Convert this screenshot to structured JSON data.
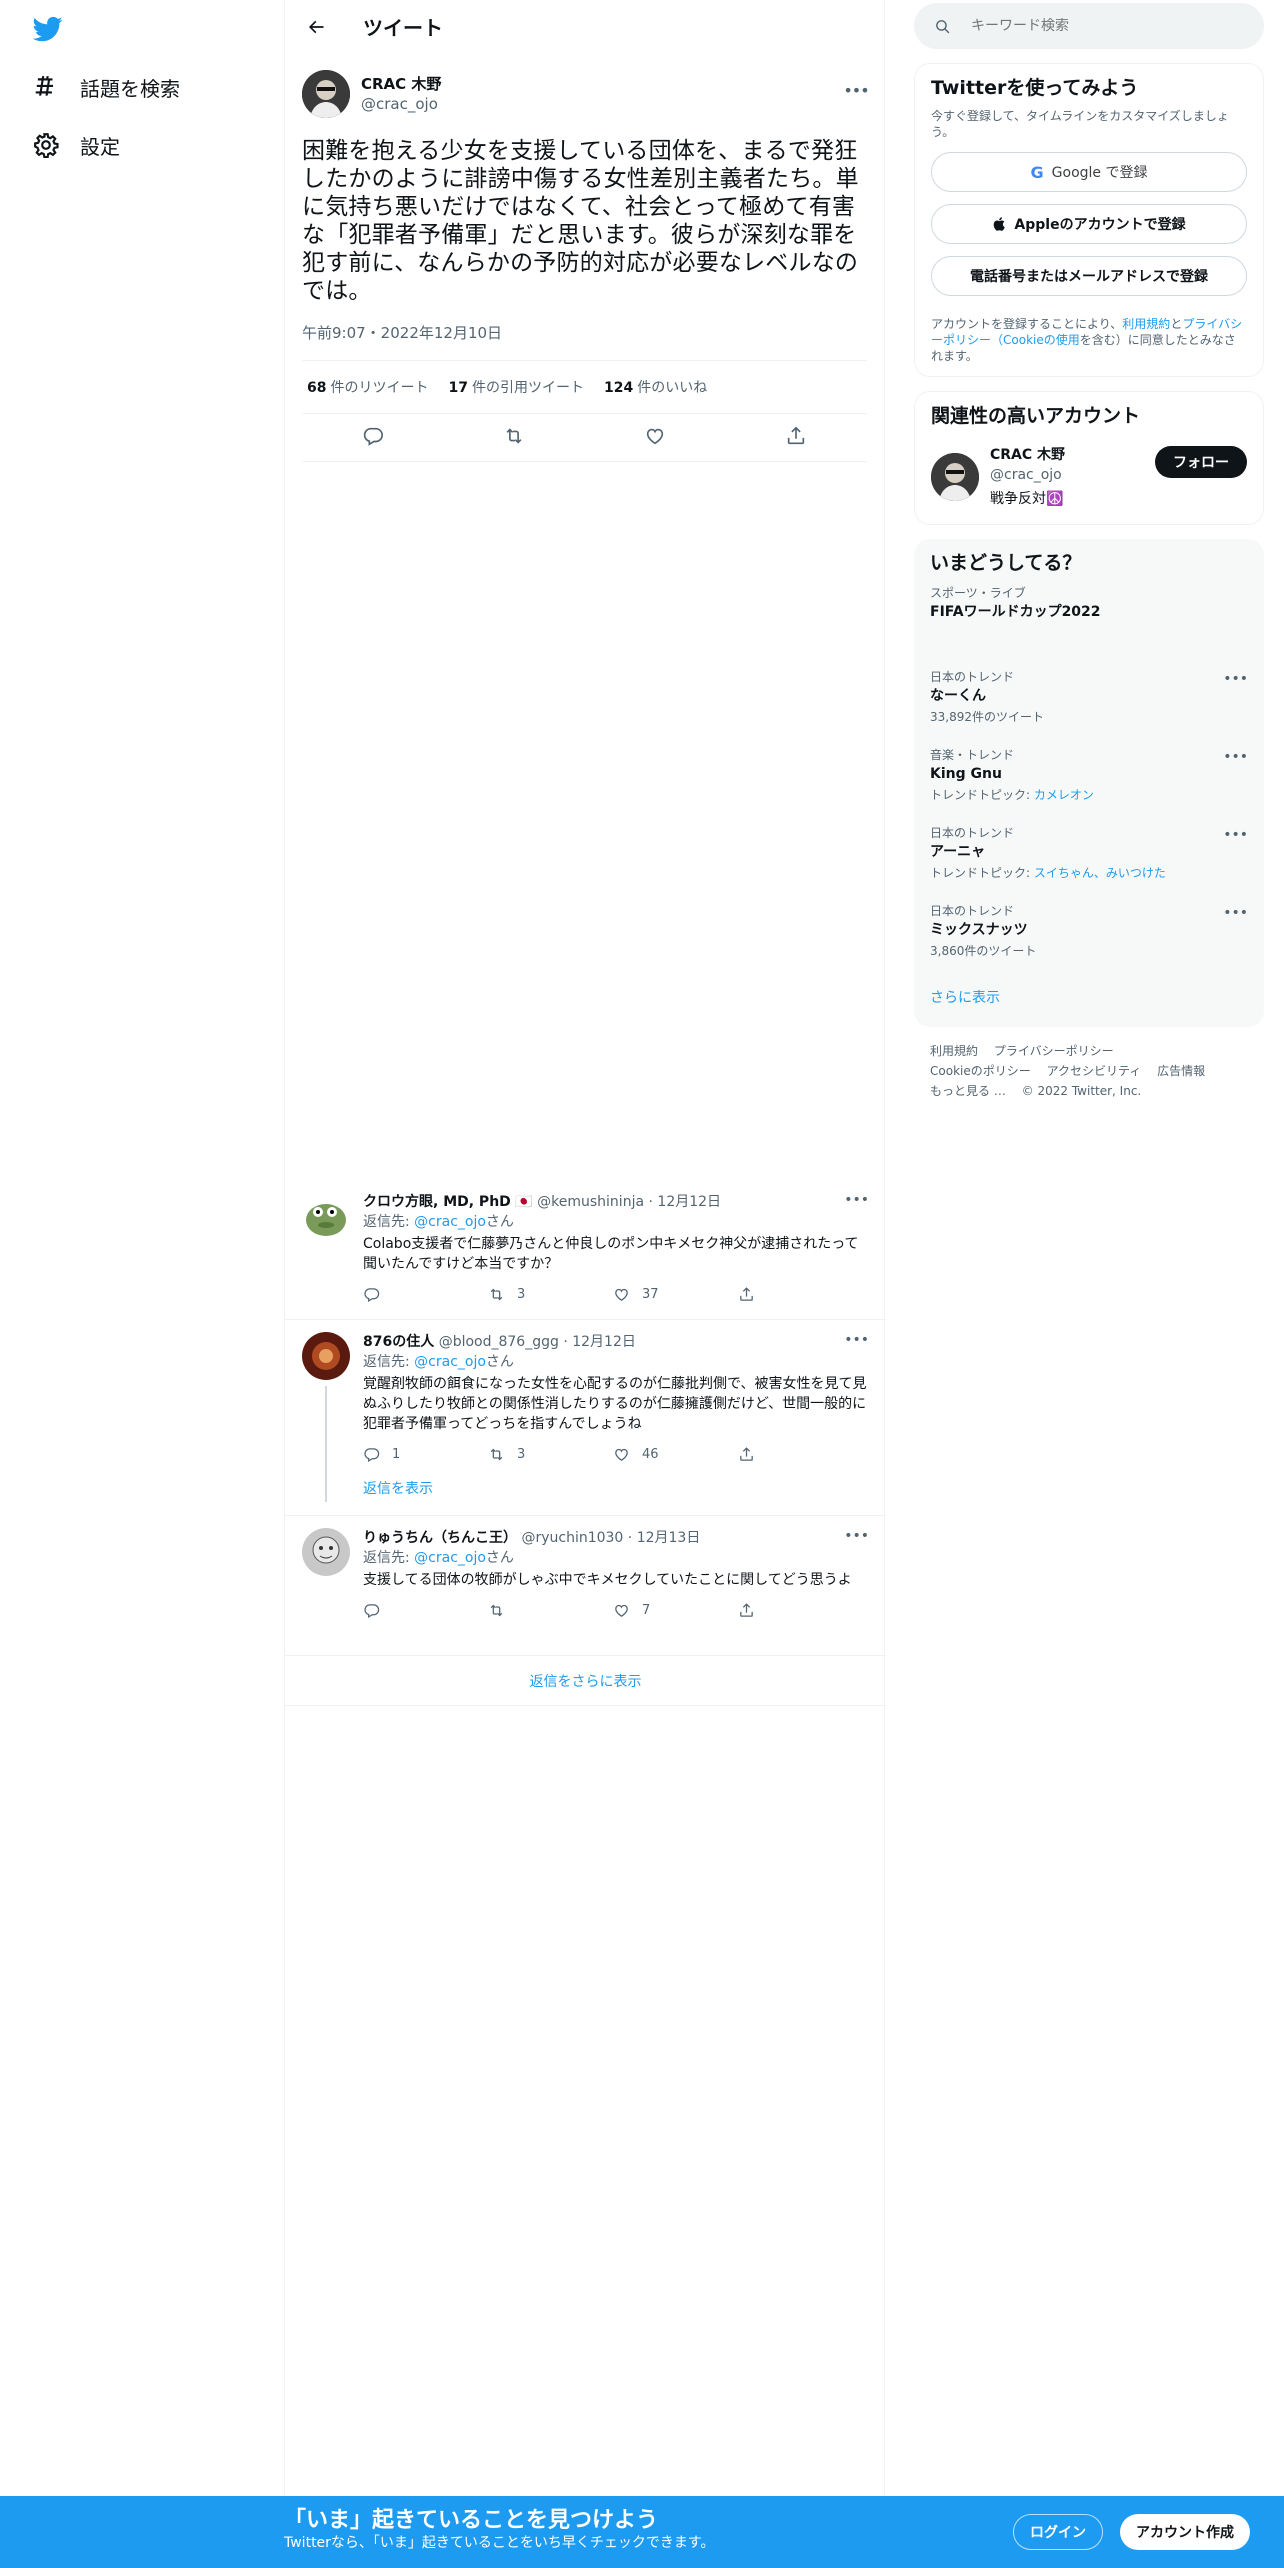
{
  "nav": {
    "logo_icon": "twitter-bird-icon",
    "items": [
      {
        "label": "話題を検索",
        "icon": "hashtag-icon"
      },
      {
        "label": "設定",
        "icon": "gear-icon"
      }
    ]
  },
  "header": {
    "title": "ツイート",
    "back_icon": "arrow-left-icon"
  },
  "tweet": {
    "author_name": "CRAC 木野",
    "author_handle": "@crac_ojo",
    "text": "困難を抱える少女を支援している団体を、まるで発狂したかのように誹謗中傷する女性差別主義者たち。単に気持ち悪いだけではなくて、社会とって極めて有害な「犯罪者予備軍」だと思います。彼らが深刻な罪を犯す前に、なんらかの予防的対応が必要なレベルなのでは。",
    "time": "午前9:07・2022年12月10日",
    "stats": [
      {
        "count": "68",
        "label": "件のリツイート"
      },
      {
        "count": "17",
        "label": "件の引用ツイート"
      },
      {
        "count": "124",
        "label": "件のいいね"
      }
    ]
  },
  "replies": [
    {
      "name": "クロウ方眼, MD, PhD",
      "flag": "🇯🇵",
      "handle": "@kemushininja",
      "date": "12月12日",
      "reply_to_prefix": "返信先: ",
      "reply_to": "@crac_ojo",
      "reply_to_suffix": "さん",
      "text": "Colabo支援者で仁藤夢乃さんと仲良しのポン中キメセク神父が逮捕されたって聞いたんですけど本当ですか？",
      "replies": "",
      "retweets": "3",
      "likes": "37"
    },
    {
      "name": "876の住人",
      "handle": "@blood_876_ggg",
      "date": "12月12日",
      "reply_to_prefix": "返信先: ",
      "reply_to": "@crac_ojo",
      "reply_to_suffix": "さん",
      "text": "覚醒剤牧師の餌食になった女性を心配するのが仁藤批判側で、被害女性を見て見ぬふりしたり牧師との関係性消したりするのが仁藤擁護側だけど、世間一般的に犯罪者予備軍ってどっちを指すんでしょうね",
      "replies": "1",
      "retweets": "3",
      "likes": "46",
      "show_replies": "返信を表示"
    },
    {
      "name": "りゅうちん（ちんこ王）",
      "handle": "@ryuchin1030",
      "date": "12月13日",
      "reply_to_prefix": "返信先: ",
      "reply_to": "@crac_ojo",
      "reply_to_suffix": "さん",
      "text": "支援してる団体の牧師がしゃぶ中でキメセクしていたことに関してどう思うよ",
      "replies": "",
      "retweets": "",
      "likes": "7"
    }
  ],
  "more_replies": "返信をさらに表示",
  "search": {
    "placeholder": "キーワード検索"
  },
  "signup": {
    "title": "Twitterを使ってみよう",
    "subtitle": "今すぐ登録して、タイムラインをカスタマイズしましょう。",
    "google": "Google で登録",
    "apple": "Appleのアカウントで登録",
    "phone": "電話番号またはメールアドレスで登録",
    "legal_1": "アカウントを登録することにより、",
    "legal_terms": "利用規約",
    "legal_2": "と",
    "legal_privacy": "プライバシーポリシー（Cookieの使用",
    "legal_3": "を含む）に同意したとみなされます。"
  },
  "related": {
    "title": "関連性の高いアカウント",
    "name": "CRAC 木野",
    "handle": "@crac_ojo",
    "bio": "戦争反対☮️",
    "follow": "フォロー"
  },
  "trends": {
    "title": "いまどうしてる？",
    "items": [
      {
        "context": "スポーツ・ライブ",
        "title": "FIFAワールドカップ2022",
        "meta": "",
        "link": ""
      },
      {
        "context": "日本のトレンド",
        "title": "なーくん",
        "meta": "33,892件のツイート",
        "link": ""
      },
      {
        "context": "音楽・トレンド",
        "title": "King Gnu",
        "meta": "トレンドトピック: ",
        "link": "カメレオン"
      },
      {
        "context": "日本のトレンド",
        "title": "アーニャ",
        "meta": "トレンドトピック: ",
        "link": "スイちゃん、みいつけた"
      },
      {
        "context": "日本のトレンド",
        "title": "ミックスナッツ",
        "meta": "3,860件のツイート",
        "link": ""
      }
    ],
    "show_more": "さらに表示"
  },
  "footer": {
    "links": [
      "利用規約",
      "プライバシーポリシー",
      "Cookieのポリシー",
      "アクセシビリティ",
      "広告情報",
      "もっと見る …",
      "© 2022 Twitter, Inc."
    ]
  },
  "banner": {
    "title": "「いま」起きていることを見つけよう",
    "subtitle": "Twitterなら、「いま」起きていることをいち早くチェックできます。",
    "login": "ログイン",
    "signup": "アカウント作成"
  },
  "colors": {
    "accent": "#1d9bf0",
    "text": "#0f1419",
    "secondary": "#536471"
  }
}
